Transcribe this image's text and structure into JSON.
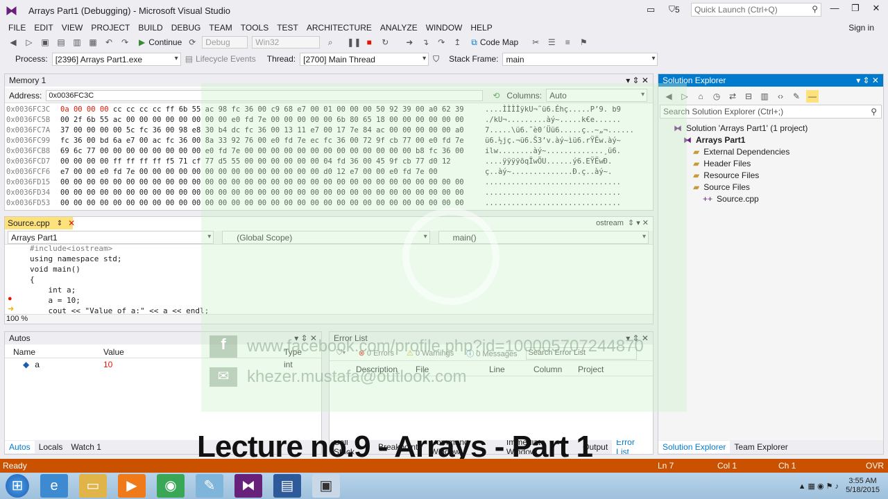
{
  "window": {
    "title": "Arrays Part1 (Debugging) - Microsoft Visual Studio",
    "quick_launch_placeholder": "Quick Launch (Ctrl+Q)",
    "notification_count": "5"
  },
  "menu": [
    "FILE",
    "EDIT",
    "VIEW",
    "PROJECT",
    "BUILD",
    "DEBUG",
    "TEAM",
    "TOOLS",
    "TEST",
    "ARCHITECTURE",
    "ANALYZE",
    "WINDOW",
    "HELP"
  ],
  "sign_in": "Sign in",
  "toolbar1": {
    "continue_label": "Continue",
    "config": "Debug",
    "platform": "Win32",
    "code_map": "Code Map"
  },
  "toolbar2": {
    "process_label": "Process:",
    "process_value": "[2396] Arrays Part1.exe",
    "lifecycle_label": "Lifecycle Events",
    "thread_label": "Thread:",
    "thread_value": "[2700] Main Thread",
    "stack_label": "Stack Frame:",
    "stack_value": "main"
  },
  "memory": {
    "title": "Memory 1",
    "address_label": "Address:",
    "address_value": "0x0036FC3C",
    "columns_label": "Columns:",
    "columns_value": "Auto",
    "rows": [
      {
        "addr": "0x0036FC3C",
        "hex": "0a 00 00 00 cc cc cc cc ff 6b 55 ac 98 fc 36 00 c9 68 e7 00 01 00 00 00 50 92 39 00 a0 62 39",
        "ascii": "....ÌÌÌÌÿkU¬˜ü6.Éhç.....P’9. b9"
      },
      {
        "addr": "0x0036FC5B",
        "hex": "00 2f 6b 55 ac 00 00 00 00 00 00 00 00 e0 fd 7e 00 00 00 00 00 6b 80 65 18 00 00 00 00 00 00",
        "ascii": "./kU¬.........àý~.....k€e......"
      },
      {
        "addr": "0x0036FC7A",
        "hex": "37 00 00 00 00 5c fc 36 00 98 e8 30 b4 dc fc 36 00 13 11 e7 00 17 7e 84 ac 00 00 00 00 00 a0",
        "ascii": "7.....\\ü6.˜è0´Üü6.....ç..~„¬......"
      },
      {
        "addr": "0x0036FC99",
        "hex": "fc 36 00 bd 6a e7 00 ac fc 36 00 8a 33 92 76 00 e0 fd 7e ec fc 36 00 72 9f cb 77 00 e0 fd 7e",
        "ascii": "ü6.½jç.¬ü6.Š3’v.àý~ìü6.rŸËw.àý~"
      },
      {
        "addr": "0x0036FCB8",
        "hex": "69 6c 77 00 00 00 00 00 00 00 00 e0 fd 7e 00 00 00 00 00 00 00 00 00 00 00 00 00 b8 fc 36 00",
        "ascii": "ilw........àý~.............¸ü6."
      },
      {
        "addr": "0x0036FCD7",
        "hex": "00 00 00 00 ff ff ff ff f5 71 cf 77 d5 55 00 00 00 00 00 00 04 fd 36 00 45 9f cb 77 d0 12",
        "ascii": "....ÿÿÿÿõqÏwÕU......ý6.EŸËwÐ."
      },
      {
        "addr": "0x0036FCF6",
        "hex": "e7 00 00 e0 fd 7e 00 00 00 00 00 00 00 00 00 00 00 00 00 00 d0 12 e7 00 00 e0 fd 7e 00",
        "ascii": "ç..àý~..............Ð.ç..àý~."
      },
      {
        "addr": "0x0036FD15",
        "hex": "00 00 00 00 00 00 00 00 00 00 00 00 00 00 00 00 00 00 00 00 00 00 00 00 00 00 00 00 00 00 00",
        "ascii": "..............................."
      },
      {
        "addr": "0x0036FD34",
        "hex": "00 00 00 00 00 00 00 00 00 00 00 00 00 00 00 00 00 00 00 00 00 00 00 00 00 00 00 00 00 00 00",
        "ascii": "..............................."
      },
      {
        "addr": "0x0036FD53",
        "hex": "00 00 00 00 00 00 00 00 00 00 00 00 00 00 00 00 00 00 00 00 00 00 00 00 00 00 00 00 00 00 00",
        "ascii": "..............................."
      }
    ]
  },
  "editor": {
    "tab_label": "Source.cpp",
    "secondary_tab": "ostream",
    "project_scope": "Arrays Part1",
    "global_scope": "(Global Scope)",
    "function_scope": "main()",
    "zoom": "100 %",
    "lines": [
      {
        "text": "#include<iostream>",
        "cls": "pp"
      },
      {
        "text": "using namespace std;",
        "cls": ""
      },
      {
        "text": "void main()",
        "cls": ""
      },
      {
        "text": "{",
        "cls": ""
      },
      {
        "text": "    int a;",
        "cls": ""
      },
      {
        "text": "    a = 10;",
        "cls": ""
      },
      {
        "text": "    cout << \"Value of a:\" << a << endl;",
        "cls": ""
      }
    ]
  },
  "autos": {
    "title": "Autos",
    "columns": [
      "Name",
      "Value",
      "Type"
    ],
    "rows": [
      {
        "name": "a",
        "value": "10",
        "type": "int"
      }
    ],
    "tabs": [
      "Autos",
      "Locals",
      "Watch 1"
    ]
  },
  "errorlist": {
    "title": "Error List",
    "errors": "0 Errors",
    "warnings": "0 Warnings",
    "messages": "0 Messages",
    "search_placeholder": "Search Error List",
    "columns": [
      "Description",
      "File",
      "Line",
      "Column",
      "Project"
    ],
    "tabs": [
      "Call Stack",
      "Breakpoints",
      "Command Window",
      "Immediate Window",
      "Output",
      "Error List"
    ]
  },
  "solution": {
    "title": "Solution Explorer",
    "search_placeholder": "Search Solution Explorer (Ctrl+;)",
    "items": [
      {
        "label": "Solution 'Arrays Part1' (1 project)",
        "indent": 1,
        "bold": false
      },
      {
        "label": "Arrays Part1",
        "indent": 2,
        "bold": true
      },
      {
        "label": "External Dependencies",
        "indent": 3,
        "bold": false
      },
      {
        "label": "Header Files",
        "indent": 3,
        "bold": false
      },
      {
        "label": "Resource Files",
        "indent": 3,
        "bold": false
      },
      {
        "label": "Source Files",
        "indent": 3,
        "bold": false
      },
      {
        "label": "Source.cpp",
        "indent": 4,
        "bold": false
      }
    ],
    "tabs": [
      "Solution Explorer",
      "Team Explorer"
    ]
  },
  "status": {
    "ready": "Ready",
    "ln": "Ln 7",
    "col": "Col 1",
    "ch": "Ch 1",
    "ovr": "OVR"
  },
  "taskbar": {
    "time": "3:55 AM",
    "date": "5/18/2015"
  },
  "overlay": {
    "lecture_title": "Lecture no.9 - Arrays - Part 1",
    "watermark_fb": "www.facebook.com/profile.php?id=100005707244870",
    "watermark_email": "khezer.mustafa@outlook.com"
  },
  "colors": {
    "accent": "#007acc",
    "status_bar": "#ca5100",
    "tab_active": "#fde17a",
    "breakpoint": "#e51400"
  }
}
